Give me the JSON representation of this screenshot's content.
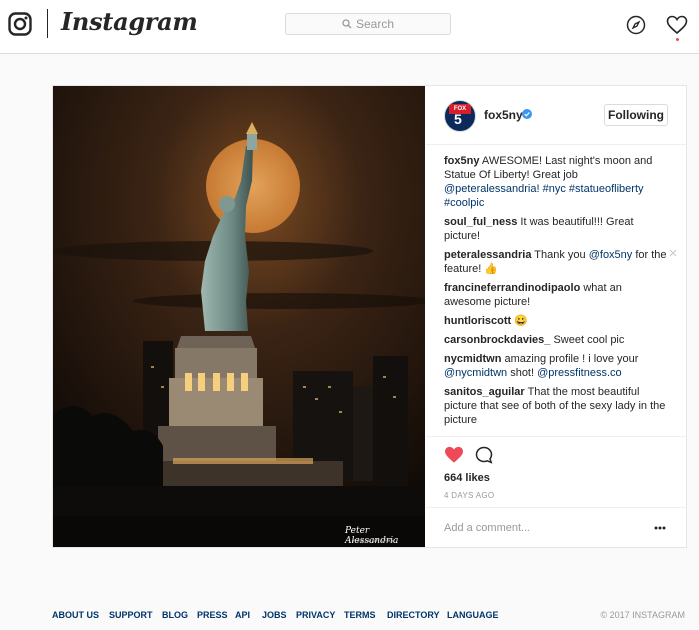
{
  "header": {
    "wordmark": "Instagram",
    "search_placeholder": "Search"
  },
  "post": {
    "username": "fox5ny",
    "avatar_text_top": "FOX",
    "avatar_text_main": "5",
    "follow_label": "Following",
    "photo_signature": "Peter Alessandria",
    "photo_signature_sub": "PHOTOGRAPHY",
    "caption": {
      "user": "fox5ny",
      "text": "AWESOME! Last night's moon and Statue Of Liberty! Great job",
      "mention": "@peteralessandria! #nyc #statueofliberty #coolpic"
    },
    "comments": [
      {
        "user": "soul_ful_ness",
        "text": "It was beautiful!!! Great picture!"
      },
      {
        "user": "peteralessandria",
        "text": "Thank you ",
        "mention": "@fox5ny",
        "text2": " for the feature! 👍"
      },
      {
        "user": "francineferrandinodipaolo",
        "text": "what an awesome picture!"
      },
      {
        "user": "huntloriscott",
        "text": "😀"
      },
      {
        "user": "carsonbrockdavies_",
        "text": "Sweet cool pic"
      },
      {
        "user": "nycmidtwn",
        "text": "amazing profile ! i love your ",
        "mention": "@nycmidtwn",
        "text2": " shot! ",
        "mention2": "@pressfitness.co"
      },
      {
        "user": "sanitos_aguilar",
        "text": "That the most beautiful picture that see of both of the sexy lady in the picture"
      }
    ],
    "likes": "664 likes",
    "time_ago": "4 DAYS AGO",
    "add_comment_placeholder": "Add a comment..."
  },
  "footer": {
    "links": [
      "ABOUT US",
      "SUPPORT",
      "BLOG",
      "PRESS",
      "API",
      "JOBS",
      "PRIVACY",
      "TERMS",
      "DIRECTORY",
      "LANGUAGE"
    ],
    "copyright": "© 2017 INSTAGRAM"
  },
  "colors": {
    "like": "#ed4956",
    "link": "#003569",
    "verified": "#3897f0"
  },
  "icons": [
    "instagram-glyph-icon",
    "search-icon",
    "compass-icon",
    "heart-icon",
    "verified-badge-icon",
    "close-icon",
    "comment-icon",
    "more-icon"
  ]
}
